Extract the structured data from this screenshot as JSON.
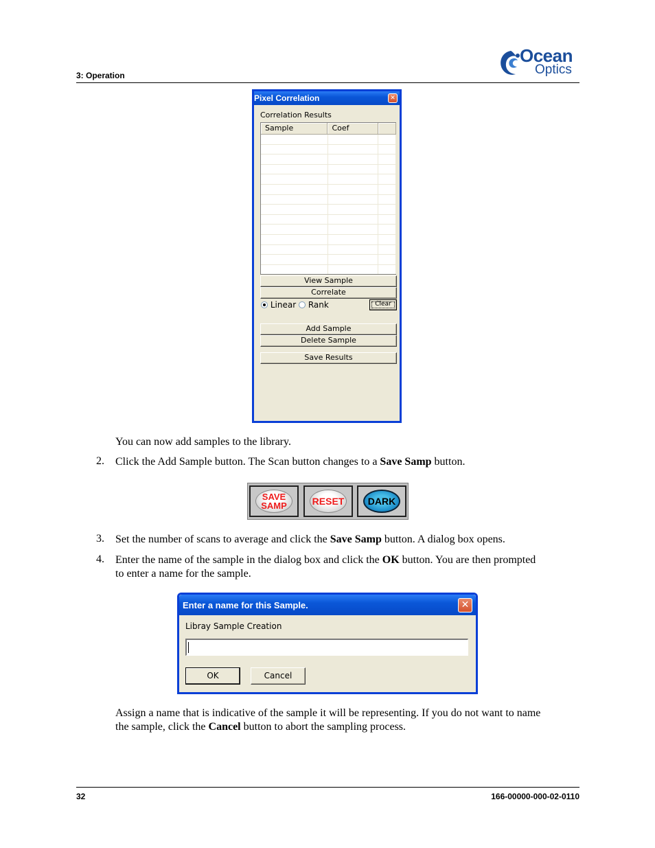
{
  "header": {
    "section_title": "3: Operation",
    "logo": {
      "word1": "Ocean",
      "word2": "Optics",
      "brand_color": "#1b4e9b"
    }
  },
  "pixel_correlation": {
    "title": "Pixel Correlation",
    "close_icon": "close-icon",
    "results_label": "Correlation Results",
    "columns": [
      "Sample",
      "Coef",
      ""
    ],
    "row_count": 14,
    "buttons": {
      "view_sample": "View Sample",
      "correlate": "Correlate",
      "clear": "Clear",
      "add_sample": "Add Sample",
      "delete_sample": "Delete Sample",
      "save_results": "Save Results"
    },
    "radio": {
      "linear": "Linear",
      "rank": "Rank",
      "selected": "Linear"
    }
  },
  "body": {
    "intro": "You can now add samples to the library.",
    "steps": [
      {
        "num": "2.",
        "pre": "Click the Add Sample button.  The Scan button changes to a ",
        "bold": "Save Samp",
        "post": " button."
      },
      {
        "num": "3.",
        "pre": "Set the number of scans to average and click the ",
        "bold": "Save Samp",
        "post": " button. A dialog box opens."
      },
      {
        "num": "4.",
        "pre": "Enter the name of the sample in the dialog box and click the ",
        "bold": "OK",
        "post_line1": " button. You are then prompted",
        "line2": "to enter a name for the sample."
      }
    ],
    "closing": {
      "line1": "Assign a name that is indicative of the sample it will be representing. If you do not want to name",
      "line2_pre": "the sample, click the ",
      "line2_bold": "Cancel",
      "line2_post": " button to abort the sampling process."
    }
  },
  "scan_buttons": [
    {
      "line1": "SAVE",
      "line2": "SAMP",
      "style": "white"
    },
    {
      "line1": "RESET",
      "line2": "",
      "style": "white"
    },
    {
      "line1": "DARK",
      "line2": "",
      "style": "blue"
    }
  ],
  "name_dialog": {
    "title": "Enter a name for this Sample.",
    "label": "Libray Sample Creation",
    "input_value": "",
    "ok": "OK",
    "cancel": "Cancel"
  },
  "footer": {
    "page_number": "32",
    "doc_number": "166-00000-000-02-0110"
  }
}
